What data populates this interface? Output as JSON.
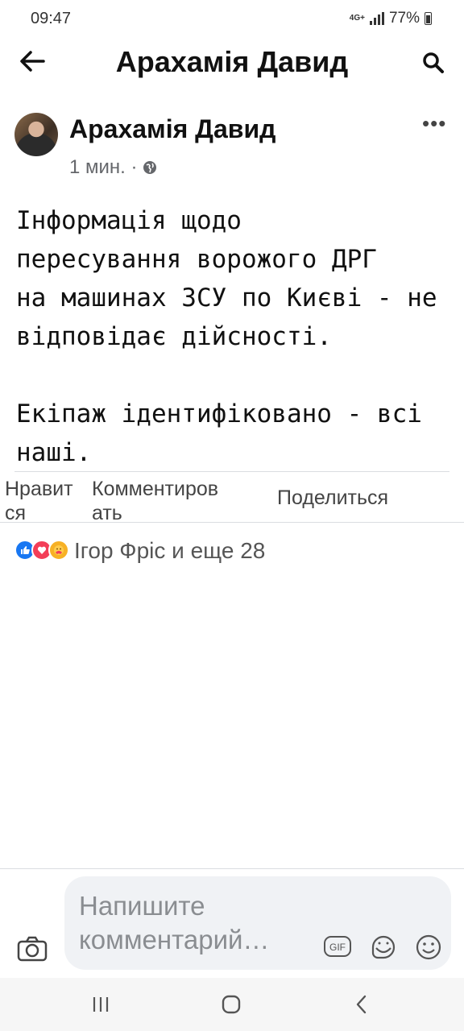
{
  "status_bar": {
    "time": "09:47",
    "network": "4G+",
    "battery": "77%"
  },
  "header": {
    "title": "Арахамія Давид",
    "back_icon": "arrow-left-icon",
    "search_icon": "search-icon"
  },
  "post": {
    "author": "Арахамія Давид",
    "time": "1 мин. ·",
    "privacy_icon": "globe-icon",
    "more_label": "•••",
    "text": "Інформація щодо\nпересування ворожого ДРГ\nна машинах ЗСУ по Києві - не\nвідповідає дійсності.\n\nЕкіпаж ідентифіковано - всі\nнаші."
  },
  "actions": {
    "like": "Нравится",
    "comment": "Комментировать",
    "share": "Поделиться"
  },
  "reactions": {
    "icons": [
      "like-icon",
      "love-icon",
      "care-icon"
    ],
    "summary": "Ігор Фріс и еще 28"
  },
  "composer": {
    "placeholder": "Напишите комментарий…",
    "icons": [
      "camera-icon",
      "gif-icon",
      "sticker-icon",
      "emoji-icon"
    ]
  },
  "colors": {
    "reaction_like": "#1877f2",
    "reaction_love": "#f33e58",
    "reaction_care": "#f7b125",
    "composer_bg": "#f0f2f5"
  }
}
